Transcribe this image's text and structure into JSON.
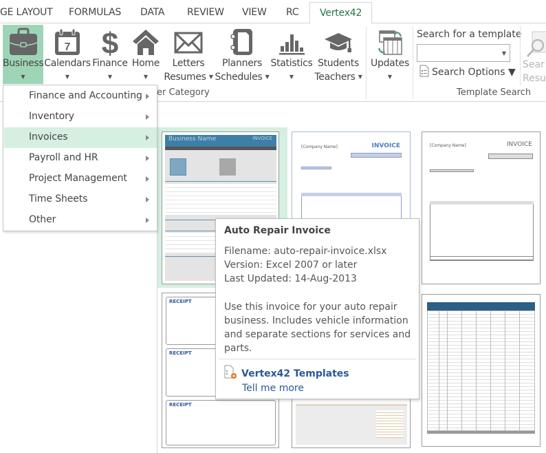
{
  "tabs": [
    {
      "label": "GE LAYOUT",
      "active": false
    },
    {
      "label": "FORMULAS",
      "active": false
    },
    {
      "label": "DATA",
      "active": false
    },
    {
      "label": "REVIEW",
      "active": false
    },
    {
      "label": "VIEW",
      "active": false
    },
    {
      "label": "RC",
      "active": false
    },
    {
      "label": "Vertex42",
      "active": true
    }
  ],
  "ribbon": {
    "categories": [
      {
        "line1": "Business",
        "line2": "",
        "icon": "briefcase-icon",
        "active": true
      },
      {
        "line1": "Calendars",
        "line2": "",
        "icon": "calendar-icon",
        "active": false
      },
      {
        "line1": "Finance",
        "line2": "",
        "icon": "dollar-icon",
        "active": false
      },
      {
        "line1": "Home",
        "line2": "",
        "icon": "home-icon",
        "active": false
      },
      {
        "line1": "Letters",
        "line2": "Resumes",
        "icon": "envelope-icon",
        "active": false
      },
      {
        "line1": "Planners",
        "line2": "Schedules",
        "icon": "planner-icon",
        "active": false
      },
      {
        "line1": "Statistics",
        "line2": "",
        "icon": "bar-chart-icon",
        "active": false
      },
      {
        "line1": "Students",
        "line2": "Teachers",
        "icon": "graduation-cap-icon",
        "active": false
      }
    ],
    "category_group_label": "er Category",
    "updates": {
      "label": "Updates",
      "icon": "updates-icon"
    },
    "search": {
      "label": "Search for a template",
      "value": "",
      "options_label": "Search Options",
      "results_line1": "Sear",
      "results_line2": "Resu",
      "group_label": "Template Search"
    }
  },
  "menu": {
    "items": [
      {
        "label": "Finance and Accounting",
        "highlighted": false
      },
      {
        "label": "Inventory",
        "highlighted": false
      },
      {
        "label": "Invoices",
        "highlighted": true
      },
      {
        "label": "Payroll and HR",
        "highlighted": false
      },
      {
        "label": "Project Management",
        "highlighted": false
      },
      {
        "label": "Time Sheets",
        "highlighted": false
      },
      {
        "label": "Other",
        "highlighted": false
      }
    ]
  },
  "gallery": {
    "thumbnails": [
      {
        "name": "auto-repair-invoice",
        "heading": "Business Name",
        "badge": "INVOICE",
        "selected": true
      },
      {
        "name": "invoice-blue",
        "heading": "[Company Name]",
        "badge": "INVOICE",
        "selected": false
      },
      {
        "name": "invoice-gray",
        "heading": "[Company Name]",
        "badge": "INVOICE",
        "selected": false
      },
      {
        "name": "receipt-template",
        "heading": "RECEIPT",
        "badge": "",
        "selected": false
      },
      {
        "name": "service-invoice",
        "heading": "",
        "badge": "",
        "selected": false
      },
      {
        "name": "invoice-tracker",
        "heading": "",
        "badge": "",
        "selected": false
      }
    ]
  },
  "tooltip": {
    "title": "Auto Repair Invoice",
    "filename": "Filename: auto-repair-invoice.xlsx",
    "version": "Version: Excel 2007 or later",
    "updated": "Last Updated: 14-Aug-2013",
    "description": "Use this invoice for your auto repair business. Includes vehicle information and separate sections for services and parts.",
    "brand": "Vertex42 Templates",
    "link": "Tell me more"
  },
  "colors": {
    "accent_green": "#217346",
    "selected_bg": "#9fd5b7",
    "highlight_bg": "#d5efe1",
    "link_blue": "#2b579a",
    "icon_gray": "#666666"
  }
}
